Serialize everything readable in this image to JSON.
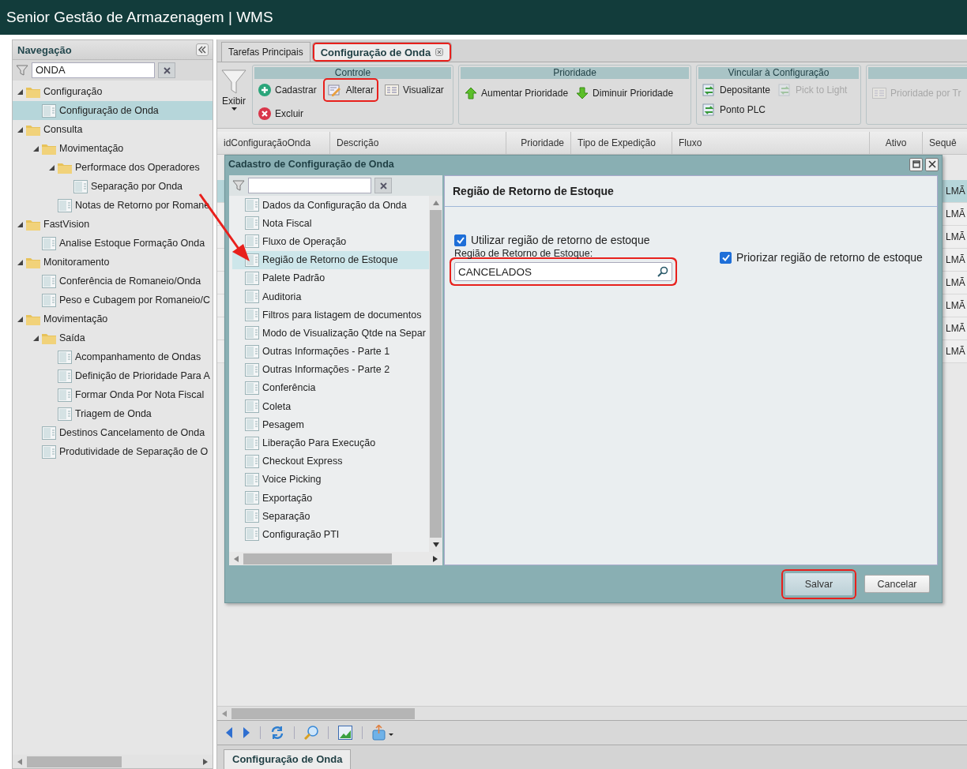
{
  "app_title": "Senior Gestão de Armazenagem | WMS",
  "sidebar": {
    "title": "Navegação",
    "filter_value": "ONDA",
    "tree": [
      {
        "label": "Configuração",
        "kind": "folder",
        "expanded": true,
        "selected": false,
        "children": [
          {
            "label": "Configuração de Onda",
            "kind": "page",
            "selected": true
          }
        ]
      },
      {
        "label": "Consulta",
        "kind": "folder",
        "expanded": true,
        "selected": false,
        "children": [
          {
            "label": "Movimentação",
            "kind": "folder",
            "expanded": true,
            "selected": false,
            "children": [
              {
                "label": "Performace dos Operadores",
                "kind": "folder",
                "expanded": true,
                "selected": false,
                "children": [
                  {
                    "label": "Separação por Onda",
                    "kind": "page",
                    "selected": false
                  }
                ]
              },
              {
                "label": "Notas de Retorno por Romane",
                "kind": "page",
                "selected": false
              }
            ]
          }
        ]
      },
      {
        "label": "FastVision",
        "kind": "folder",
        "expanded": true,
        "selected": false,
        "children": [
          {
            "label": "Analise Estoque Formação Onda",
            "kind": "page",
            "selected": false
          }
        ]
      },
      {
        "label": "Monitoramento",
        "kind": "folder",
        "expanded": true,
        "selected": false,
        "children": [
          {
            "label": "Conferência de Romaneio/Onda",
            "kind": "page",
            "selected": false
          },
          {
            "label": "Peso e Cubagem por Romaneio/C",
            "kind": "page",
            "selected": false
          }
        ]
      },
      {
        "label": "Movimentação",
        "kind": "folder",
        "expanded": true,
        "selected": false,
        "children": [
          {
            "label": "Saída",
            "kind": "folder",
            "expanded": true,
            "selected": false,
            "children": [
              {
                "label": "Acompanhamento de Ondas",
                "kind": "page",
                "selected": false
              },
              {
                "label": "Definição de Prioridade Para A",
                "kind": "page",
                "selected": false
              },
              {
                "label": "Formar Onda Por Nota Fiscal",
                "kind": "page",
                "selected": false
              },
              {
                "label": "Triagem de Onda",
                "kind": "page",
                "selected": false
              }
            ]
          },
          {
            "label": "Destinos Cancelamento de Onda",
            "kind": "page",
            "selected": false
          },
          {
            "label": "Produtividade de Separação de O",
            "kind": "page",
            "selected": false
          }
        ]
      }
    ]
  },
  "tabs": [
    {
      "label": "Tarefas Principais",
      "selected": false,
      "closable": false,
      "annotated": false
    },
    {
      "label": "Configuração de Onda",
      "selected": true,
      "closable": true,
      "annotated": true
    }
  ],
  "toolbar": {
    "exibir_label": "Exibir",
    "groups": [
      {
        "title": "Controle",
        "rows": [
          [
            {
              "label": "Cadastrar",
              "kind": "add",
              "disabled": false,
              "annotated": false
            },
            {
              "label": "Alterar",
              "kind": "edit",
              "disabled": false,
              "annotated": true
            },
            {
              "label": "Visualizar",
              "kind": "view",
              "disabled": false,
              "annotated": false
            }
          ],
          [
            {
              "label": "Excluir",
              "kind": "delete",
              "disabled": false,
              "annotated": false
            }
          ]
        ]
      },
      {
        "title": "Prioridade",
        "rows": [
          [
            {
              "label": "Aumentar Prioridade",
              "kind": "up",
              "disabled": false,
              "annotated": false
            },
            {
              "label": "Diminuir Prioridade",
              "kind": "down",
              "disabled": false,
              "annotated": false
            }
          ]
        ]
      },
      {
        "title": "Vincular à Configuração",
        "rows": [
          [
            {
              "label": "Depositante",
              "kind": "link",
              "disabled": false,
              "annotated": false
            },
            {
              "label": "Pick to Light",
              "kind": "link",
              "disabled": true,
              "annotated": false
            }
          ],
          [
            {
              "label": "Ponto PLC",
              "kind": "link",
              "disabled": false,
              "annotated": false
            }
          ]
        ]
      },
      {
        "rows": [
          [
            {
              "label": "Prioridade por Tr",
              "kind": "view",
              "disabled": true,
              "annotated": false
            }
          ]
        ]
      }
    ]
  },
  "table": {
    "columns": [
      "idConfiguraçãoOnda",
      "Descrição",
      "Prioridade",
      "Tipo de Expedição",
      "Fluxo",
      "Ativo",
      "Sequê"
    ],
    "rows": [
      {
        "selected": true,
        "column_7": "LMÃ"
      },
      {
        "selected": false,
        "column_7": "LMÃ"
      },
      {
        "selected": false,
        "column_7": "LMÃ"
      },
      {
        "selected": false,
        "column_7": "LMÃ"
      },
      {
        "selected": false,
        "column_7": "LMÃ"
      },
      {
        "selected": false,
        "column_7": "LMÃ"
      },
      {
        "selected": false,
        "column_7": "LMÃ"
      },
      {
        "selected": false,
        "column_7": "LMÃ"
      }
    ]
  },
  "dialog": {
    "title": "Cadastro de Configuração de Onda",
    "nav": [
      {
        "label": "Dados da Configuração da Onda",
        "selected": false
      },
      {
        "label": "Nota Fiscal",
        "selected": false
      },
      {
        "label": "Fluxo de Operação",
        "selected": false
      },
      {
        "label": "Região de Retorno de Estoque",
        "selected": true
      },
      {
        "label": "Palete Padrão",
        "selected": false
      },
      {
        "label": "Auditoria",
        "selected": false
      },
      {
        "label": "Filtros para listagem de documentos",
        "selected": false
      },
      {
        "label": "Modo de Visualização Qtde na Separ",
        "selected": false
      },
      {
        "label": "Outras Informações - Parte 1",
        "selected": false
      },
      {
        "label": "Outras Informações - Parte 2",
        "selected": false
      },
      {
        "label": "Conferência",
        "selected": false
      },
      {
        "label": "Coleta",
        "selected": false
      },
      {
        "label": "Pesagem",
        "selected": false
      },
      {
        "label": "Liberação Para Execução",
        "selected": false
      },
      {
        "label": "Checkout Express",
        "selected": false
      },
      {
        "label": "Voice Picking",
        "selected": false
      },
      {
        "label": "Exportação",
        "selected": false
      },
      {
        "label": "Separação",
        "selected": false
      },
      {
        "label": "Configuração PTI",
        "selected": false
      }
    ],
    "heading": "Região de Retorno de Estoque",
    "checkboxes": [
      {
        "label": "Utilizar região de retorno de estoque",
        "checked": true
      },
      {
        "label": "Priorizar região de retorno de estoque",
        "checked": true
      }
    ],
    "field": {
      "label": "Região de Retorno de Estoque:",
      "value": "CANCELADOS",
      "annotated": true
    },
    "buttons": [
      {
        "label": "Salvar",
        "kind": "primary",
        "annotated": true
      },
      {
        "label": "Cancelar",
        "kind": "secondary",
        "annotated": false
      }
    ]
  },
  "bottom_tab": "Configuração de Onda"
}
